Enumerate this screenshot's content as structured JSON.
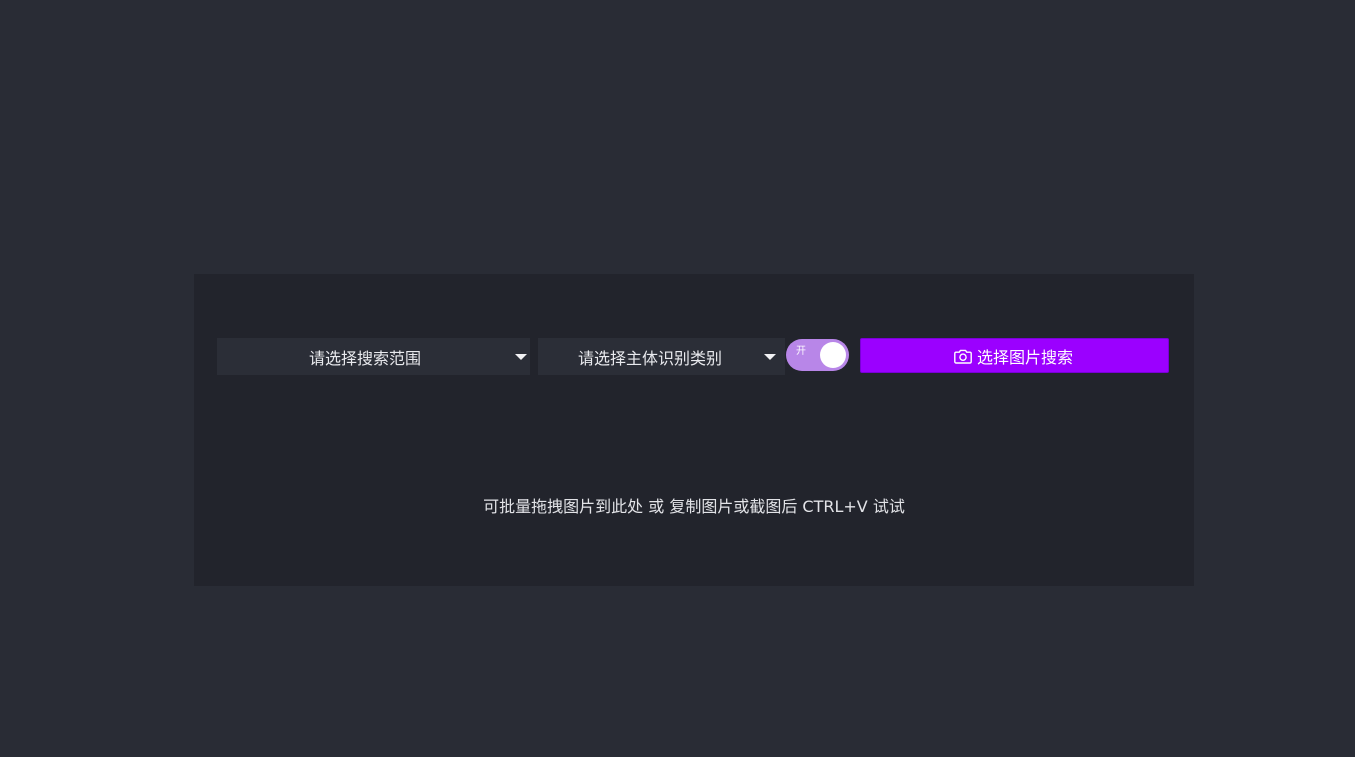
{
  "toolbar": {
    "scope_select": {
      "label": "请选择搜索范围",
      "icon": "chevron-down-icon"
    },
    "category_select": {
      "label": "请选择主体识别类别",
      "icon": "chevron-down-icon"
    },
    "toggle": {
      "label": "开",
      "state": "on",
      "color": "#b886e8"
    },
    "search_button": {
      "label": "选择图片搜索",
      "icon": "camera-icon",
      "color": "#9b00ff"
    }
  },
  "hint": {
    "text": "可批量拖拽图片到此处 或 复制图片或截图后 CTRL+V 试试"
  },
  "colors": {
    "page_background": "#292c35",
    "panel_background": "#22242c",
    "control_background": "#2b2e37"
  }
}
